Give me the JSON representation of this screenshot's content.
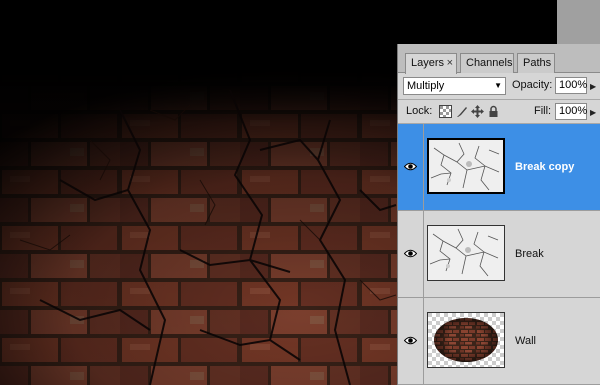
{
  "layers_panel": {
    "tabs": [
      {
        "label": "Layers",
        "active": true,
        "has_close": true
      },
      {
        "label": "Channels",
        "active": false
      },
      {
        "label": "Paths",
        "active": false
      }
    ],
    "blend_mode": "Multiply",
    "opacity_label": "Opacity:",
    "opacity_value": "100%",
    "lock_label": "Lock:",
    "lock_icons": [
      "lock-transparent-pixels-icon",
      "lock-image-pixels-icon",
      "lock-position-icon",
      "lock-all-icon"
    ],
    "fill_label": "Fill:",
    "fill_value": "100%",
    "layers": [
      {
        "name": "Break copy",
        "visible": true,
        "selected": true,
        "thumbnail": "cracked-texture"
      },
      {
        "name": "Break",
        "visible": true,
        "selected": false,
        "thumbnail": "cracked-texture"
      },
      {
        "name": "Wall",
        "visible": true,
        "selected": false,
        "thumbnail": "brick-wall-on-transparency"
      }
    ]
  },
  "colors": {
    "selected_row": "#3d8fe6",
    "panel_bg": "#d6d6d6",
    "canvas_bg": "#000000"
  }
}
